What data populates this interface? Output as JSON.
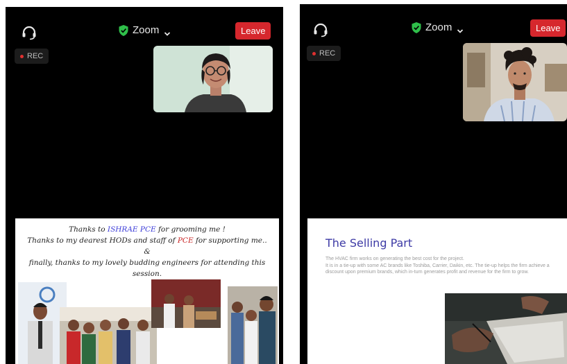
{
  "left_screen": {
    "app_title": "Zoom",
    "leave_label": "Leave",
    "rec_label": "REC",
    "slide": {
      "line1_prefix": "Thanks to ",
      "line1_highlight": "ISHRAE PCE",
      "line1_suffix": " for grooming me !",
      "line2_prefix": "Thanks to my dearest HODs and staff of ",
      "line2_highlight": "PCE",
      "line2_suffix": " for supporting me.. &",
      "line3": "finally, thanks to my lovely budding engineers for attending this",
      "line4": "session."
    }
  },
  "right_screen": {
    "app_title": "Zoom",
    "leave_label": "Leave",
    "rec_label": "REC",
    "slide": {
      "title": "The Selling Part",
      "body_1": "The HVAC firm works on generating the best cost for the project.",
      "body_2": "It is in a tie-up with some AC brands like Toshiba, Carrier, Daikin, etc. The tie-up helps the firm achieve a discount upon premium brands, which in-turn generates profit and revenue for the firm to grow."
    }
  },
  "colors": {
    "background": "#000000",
    "leave_button": "#d6272d",
    "shield": "#2fbf4a",
    "slide_title": "#3d3aa5",
    "highlight_blue": "#3b3bd8",
    "highlight_red": "#c82020"
  },
  "icons": [
    "headset-icon",
    "shield-check-icon",
    "chevron-down-icon",
    "rec-dot-icon"
  ]
}
